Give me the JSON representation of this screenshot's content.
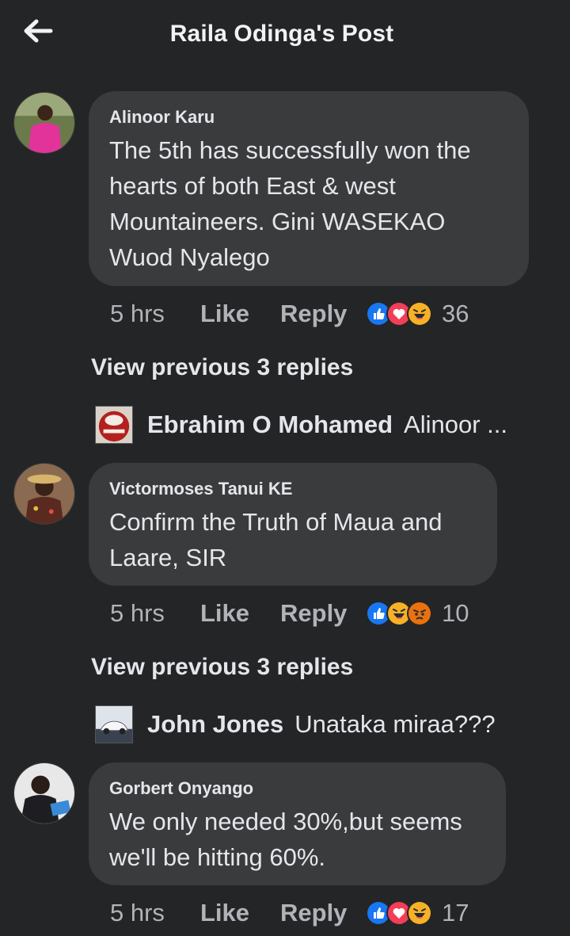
{
  "header": {
    "title": "Raila Odinga's Post",
    "back_icon": "arrow-left-icon"
  },
  "comments": [
    {
      "author": "Alinoor Karu",
      "lines": [
        "The 5th has successfully won the",
        "hearts of both East & west",
        "Mountaineers. Gini WASEKAO",
        "Wuod Nyalego"
      ],
      "time": "5 hrs",
      "like": "Like",
      "reply": "Reply",
      "reactions": [
        "like",
        "love",
        "haha"
      ],
      "reaction_count": "36",
      "view_previous": "View previous 3 replies",
      "latest_reply": {
        "name": "Ebrahim O Mohamed",
        "text": "Alinoor ..."
      }
    },
    {
      "author": "Victormoses Tanui KE",
      "lines": [
        "Confirm the Truth of Maua and",
        "Laare, SIR"
      ],
      "time": "5 hrs",
      "like": "Like",
      "reply": "Reply",
      "reactions": [
        "like",
        "haha",
        "angry"
      ],
      "reaction_count": "10",
      "view_previous": "View previous 3 replies",
      "latest_reply": {
        "name": "John Jones",
        "text": "Unataka miraa???"
      }
    },
    {
      "author": "Gorbert Onyango",
      "lines": [
        "We only needed 30%,but seems",
        "we'll be hitting 60%."
      ],
      "time": "5 hrs",
      "like": "Like",
      "reply": "Reply",
      "reactions": [
        "like",
        "love",
        "haha"
      ],
      "reaction_count": "17"
    }
  ],
  "colors": {
    "background": "#242526",
    "bubble": "#3a3b3c",
    "text": "#e4e6eb",
    "muted": "#b0b3b8",
    "like_blue": "#1877f2",
    "love_red": "#f33e58",
    "haha_yellow": "#f7b125",
    "angry_orange": "#e9710f"
  }
}
